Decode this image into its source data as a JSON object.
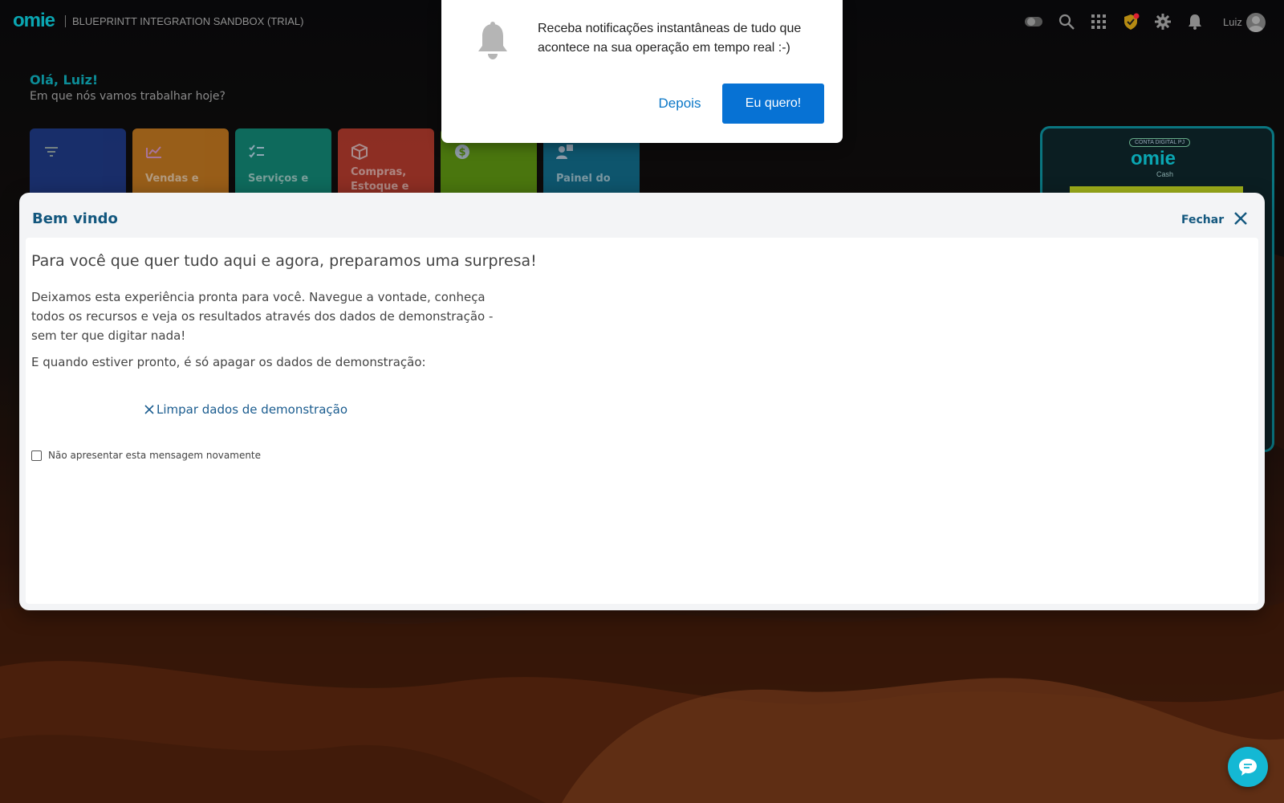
{
  "topbar": {
    "logo": "omie",
    "company": "BLUEPRINTT INTEGRATION SANDBOX (TRIAL)",
    "user_name": "Luiz",
    "icons": [
      "theme-toggle-icon",
      "search-icon",
      "apps-grid-icon",
      "security-shield-icon",
      "gear-icon",
      "bell-icon"
    ]
  },
  "greeting": {
    "hello": "Olá, Luiz!",
    "subtitle": "Em que nós vamos trabalhar hoje?"
  },
  "tiles": [
    {
      "label": "",
      "color": "#1d3a8a",
      "icon": "filter-icon"
    },
    {
      "label": "Vendas e",
      "color": "#c77a1e",
      "icon": "sales-chart-icon"
    },
    {
      "label": "Serviços e",
      "color": "#0f8a78",
      "icon": "checklist-icon"
    },
    {
      "label": "Compras,\nEstoque e",
      "color": "#b83a2c",
      "icon": "box-icon"
    },
    {
      "label": "",
      "color": "#5f9a10",
      "icon": "dollar-icon"
    },
    {
      "label": "Painel do",
      "color": "#0f6f8f",
      "icon": "user-panel-icon"
    }
  ],
  "promo": {
    "badge": "CONTA DIGITAL PJ",
    "logo": "omie",
    "subtitle": "Cash"
  },
  "notification": {
    "message": "Receba notificações instantâneas de tudo que acontece na sua operação em tempo real :-)",
    "later_label": "Depois",
    "accept_label": "Eu quero!"
  },
  "modal": {
    "title": "Bem vindo",
    "close_label": "Fechar",
    "heading": "Para você que quer tudo aqui e agora, preparamos uma surpresa!",
    "paragraph1": "Deixamos esta experiência pronta para você. Navegue a vontade, conheça todos os recursos e veja os resultados através dos dados de demonstração - sem ter que digitar nada!",
    "paragraph2": "E quando estiver pronto, é só apagar os dados de demonstração:",
    "clear_link": "Limpar dados de demonstração",
    "dont_show_label": "Não apresentar esta mensagem novamente"
  },
  "colors": {
    "brand": "#0aa6b2",
    "primary_button": "#0772d4",
    "modal_title": "#13577e",
    "chat": "#14b8d4"
  }
}
